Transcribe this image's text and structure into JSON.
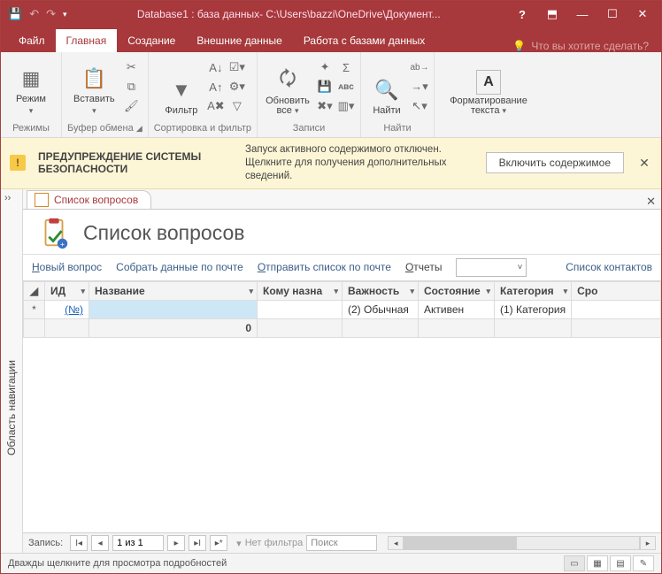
{
  "titlebar": {
    "title": "Database1 : база данных- C:\\Users\\bazzi\\OneDrive\\Документ..."
  },
  "tabs": {
    "file": "Файл",
    "home": "Главная",
    "create": "Создание",
    "external": "Внешние данные",
    "dbtools": "Работа с базами данных",
    "tellme": "Что вы хотите сделать?"
  },
  "ribbon": {
    "view": "Режим",
    "views_caption": "Режимы",
    "paste": "Вставить",
    "clipboard_caption": "Буфер обмена",
    "filter": "Фильтр",
    "sortfilter_caption": "Сортировка и фильтр",
    "refresh_l1": "Обновить",
    "refresh_l2": "все",
    "records_caption": "Записи",
    "find": "Найти",
    "find_caption": "Найти",
    "textfmt_l1": "Форматирование",
    "textfmt_l2": "текста",
    "a_glyph": "А"
  },
  "security": {
    "heading": "ПРЕДУПРЕЖДЕНИЕ СИСТЕМЫ БЕЗОПАСНОСТИ",
    "message": "Запуск активного содержимого отключен. Щелкните для получения дополнительных сведений.",
    "button": "Включить содержимое"
  },
  "navpane": {
    "label": "Область навигации"
  },
  "doc": {
    "tab": "Список вопросов",
    "title": "Список вопросов"
  },
  "cmds": {
    "new": "Новый вопрос",
    "collect": "Собрать данные по почте",
    "send": "Отправить список по почте",
    "reports": "Отчеты",
    "contacts": "Список контактов"
  },
  "cols": {
    "id": "ИД",
    "name": "Название",
    "assigned": "Кому назна",
    "priority": "Важность",
    "state": "Состояние",
    "category": "Категория",
    "due": "Сро"
  },
  "row": {
    "id": "(№)",
    "priority": "(2) Обычная",
    "state": "Активен",
    "category": "(1) Категория"
  },
  "totals": {
    "count": "0"
  },
  "recnav": {
    "label": "Запись:",
    "pos": "1 из 1",
    "nofilter": "Нет фильтра",
    "search": "Поиск"
  },
  "status": {
    "msg": "Дважды щелкните для просмотра подробностей"
  }
}
